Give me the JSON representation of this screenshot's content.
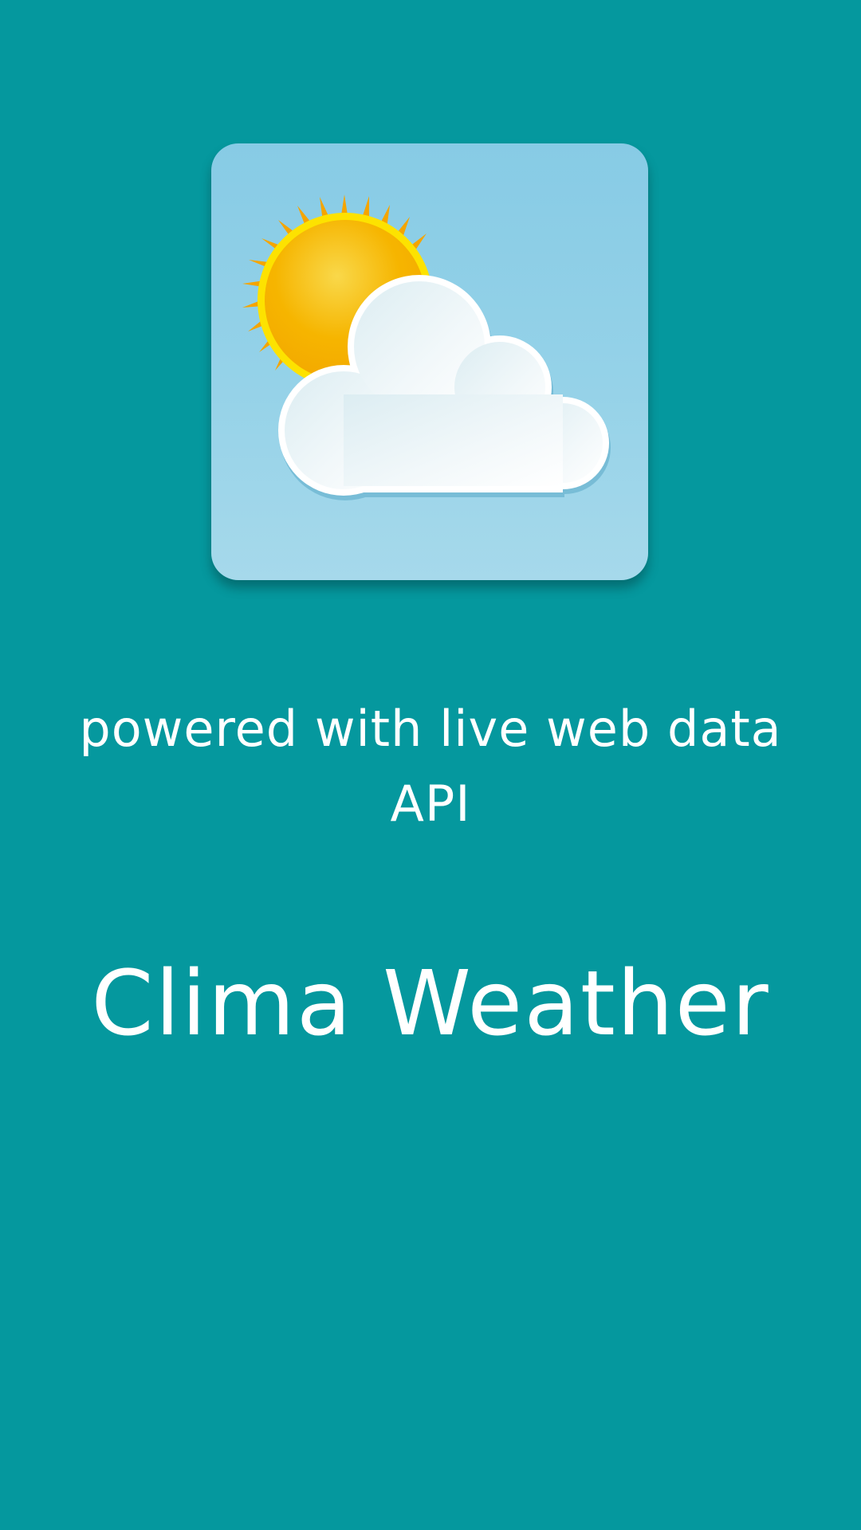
{
  "splash": {
    "logo_icon": "sun-behind-cloud-icon",
    "tagline": "powered with live web data API",
    "app_name": "Clima Weather"
  },
  "colors": {
    "background": "#05989e",
    "icon_sky": "#87cbe5",
    "sun": "#f6b500",
    "cloud": "#ffffff",
    "text": "#ffffff"
  }
}
